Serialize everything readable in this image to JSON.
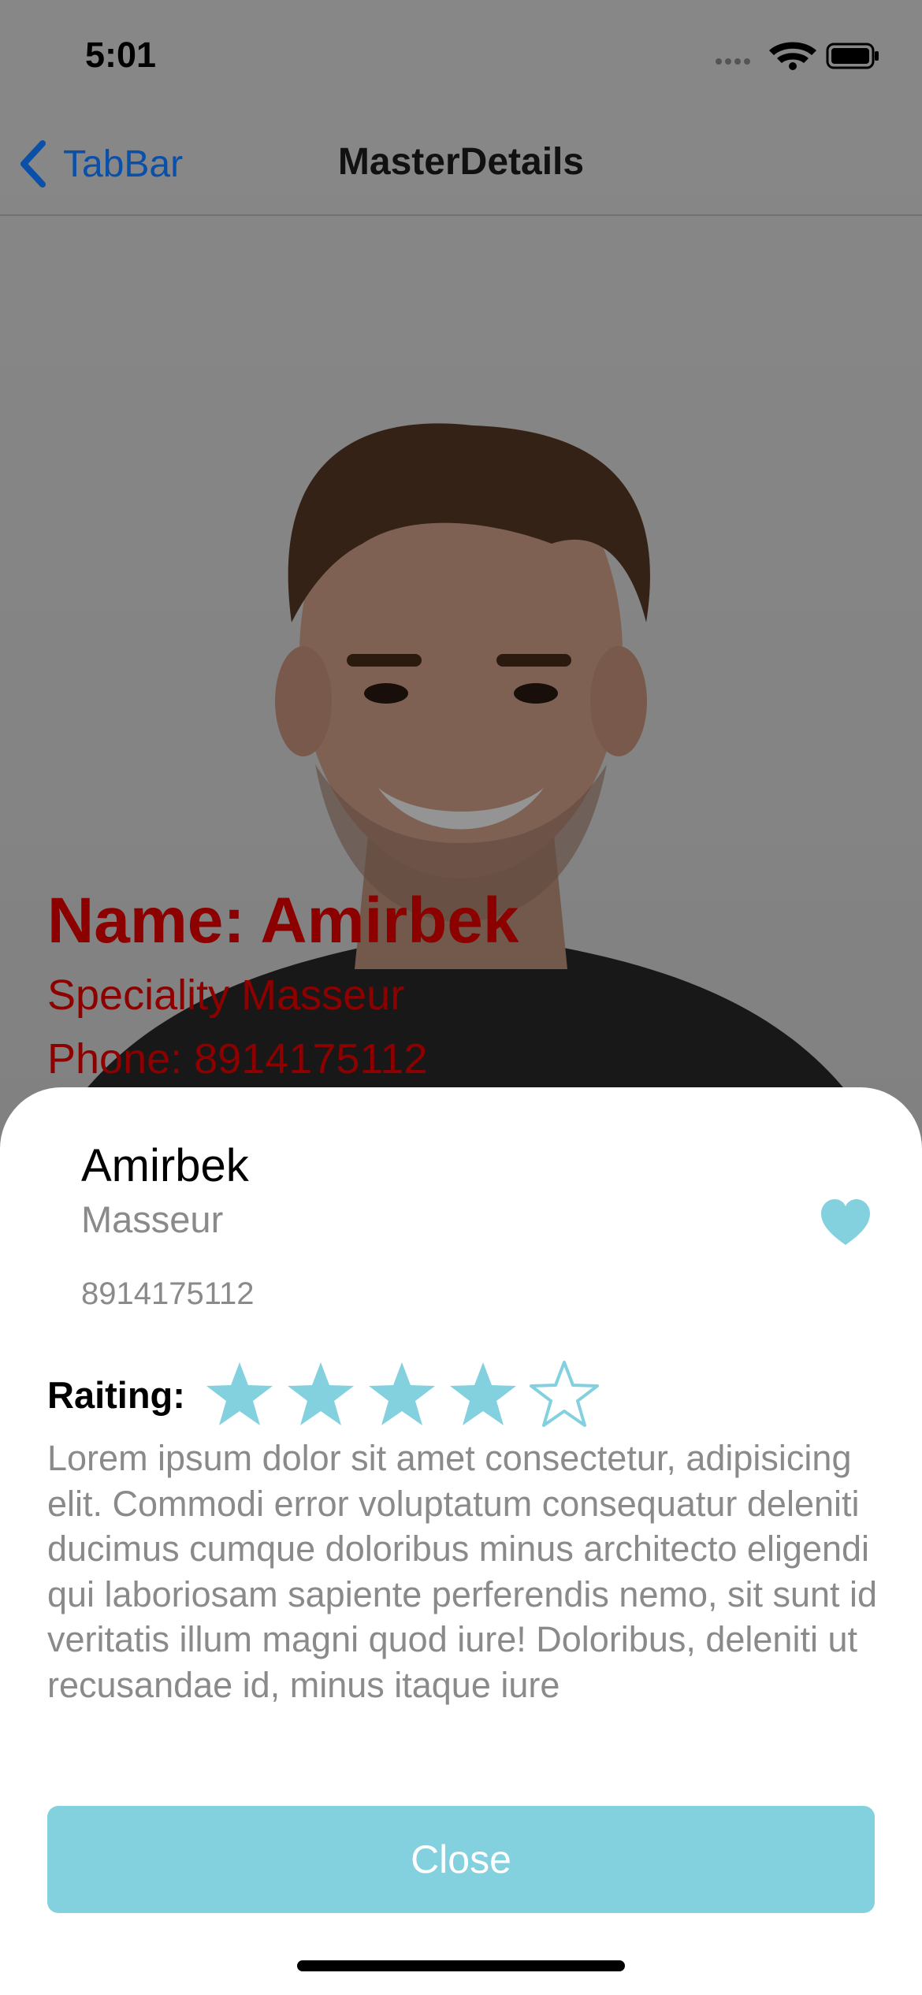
{
  "status_bar": {
    "time": "5:01",
    "icons": [
      "signal-icon",
      "wifi-icon",
      "battery-icon"
    ]
  },
  "navbar": {
    "back_label": "TabBar",
    "title": "MasterDetails"
  },
  "overlay": {
    "name": "Name: Amirbek",
    "speciality": "Speciality Masseur",
    "phone": "Phone: 8914175112"
  },
  "sheet": {
    "name": "Amirbek",
    "speciality": "Masseur",
    "phone": "8914175112",
    "favorite_icon": "heart-icon",
    "rating_label": "Raiting:",
    "rating": {
      "value": 4,
      "max": 5
    },
    "description": "Lorem ipsum dolor sit amet consectetur, adipisicing elit. Commodi error voluptatum consequatur deleniti ducimus cumque doloribus minus architecto eligendi qui laboriosam sapiente perferendis nemo, sit sunt id veritatis illum magni quod iure! Doloribus, deleniti ut recusandae id, minus itaque iure",
    "close_label": "Close"
  },
  "colors": {
    "accent": "#83d0df",
    "overlay_text": "#8c0000",
    "link": "#0a4fa8"
  }
}
